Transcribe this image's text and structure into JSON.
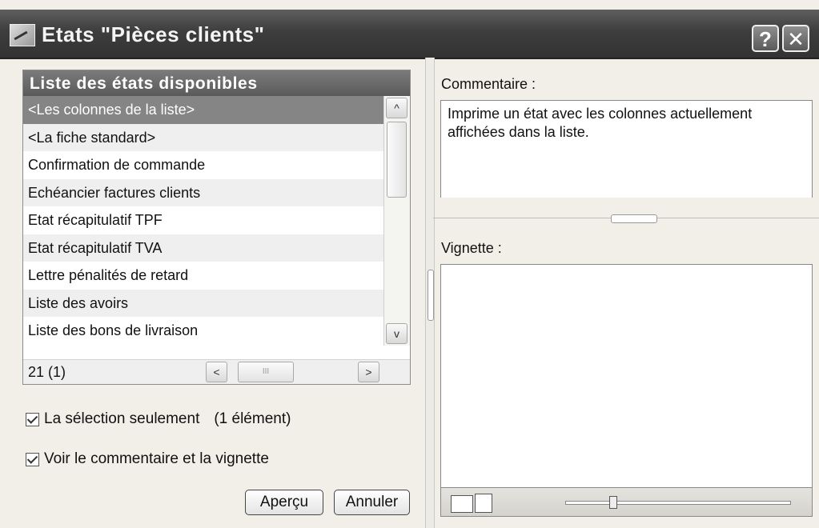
{
  "window": {
    "title": "Etats \"Pièces clients\"",
    "help_label": "?",
    "close_label": "✕"
  },
  "report_list": {
    "header": "Liste des états disponibles",
    "items": [
      {
        "label": "<Les colonnes de la liste>",
        "selected": true
      },
      {
        "label": "<La fiche standard>"
      },
      {
        "label": "Confirmation de commande"
      },
      {
        "label": "Echéancier factures clients"
      },
      {
        "label": "Etat récapitulatif TPF"
      },
      {
        "label": "Etat récapitulatif TVA"
      },
      {
        "label": "Lettre pénalités de retard"
      },
      {
        "label": "Liste des avoirs"
      },
      {
        "label": "Liste des bons de livraison"
      }
    ],
    "count": "21 (1)",
    "scroll_up": "^",
    "scroll_down": "v",
    "scroll_left": "<",
    "scroll_right": ">",
    "hthumb_grip": "III"
  },
  "options": {
    "selection_only_label": "La sélection seulement",
    "selection_count": "(1 élément)",
    "selection_only_checked": true,
    "show_comment_label": "Voir le commentaire et la vignette",
    "show_comment_checked": true
  },
  "buttons": {
    "preview": "Aperçu",
    "cancel": "Annuler"
  },
  "comment": {
    "label": "Commentaire :",
    "text": "Imprime un état avec les colonnes actuellement affichées dans la liste."
  },
  "vignette": {
    "label": "Vignette :",
    "zoom_level": 0.2
  },
  "colors": {
    "selected_row": "#858585",
    "title_bar": "#3d3d3d",
    "list_header": "#6a6a6a"
  },
  "icons": [
    "app-report-icon",
    "help-icon",
    "close-icon",
    "fit-width-icon",
    "fit-page-icon"
  ]
}
